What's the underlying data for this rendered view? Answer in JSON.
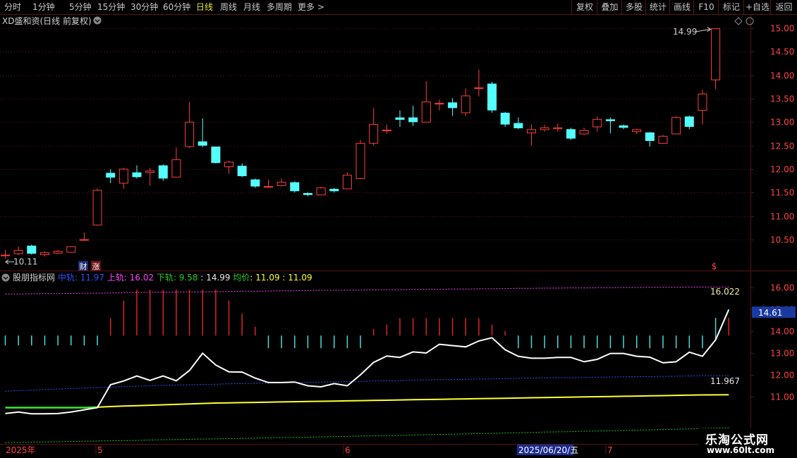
{
  "toolbar": {
    "periods": [
      "分时",
      "1分钟",
      "5分钟",
      "15分钟",
      "30分钟",
      "60分钟",
      "日线",
      "周线",
      "月线",
      "多周期",
      "更多 >"
    ],
    "active_period": "日线",
    "right_buttons": [
      "复权",
      "叠加",
      "多股",
      "统计",
      "画线",
      "F10",
      "标记",
      "+自选",
      "返回"
    ]
  },
  "main_chart": {
    "stock_title": "XD盛和资(日线 前复权)",
    "price_axis": [
      "15.00",
      "14.50",
      "14.00",
      "13.50",
      "13.00",
      "12.50",
      "12.00",
      "11.50",
      "11.00",
      "10.50"
    ],
    "high_label": "14.99",
    "low_label": "10.11",
    "badge_cai": "财",
    "badge_zhang": "涨",
    "s_marker": "$"
  },
  "indicator": {
    "name": "股朋指标网",
    "mid_label": "中轨",
    "mid_value": "11.97",
    "upper_label": "上轨",
    "upper_value": "16.02",
    "lower_label": "下轨",
    "lower_value": "9.58",
    "close_value": "14.99",
    "avg_label": "均价",
    "avg_value": "11.09",
    "avg_value2": "11.09",
    "upper_tag": "16.022",
    "mid_tag": "11.967",
    "current_tag": "14.61",
    "axis": [
      "16.00",
      "15.00",
      "14.00",
      "13.00",
      "12.00",
      "11.00"
    ]
  },
  "time_axis": {
    "year_label": "2025年",
    "month_5": "5",
    "month_6": "6",
    "month_7": "7",
    "cursor_date": "2025/06/20/五"
  },
  "watermark": {
    "title": "乐淘公式网",
    "url": "www.60lt.com"
  },
  "colors": {
    "up": "#ff3c3c",
    "down": "#54ffff",
    "grid": "#5a1414",
    "axis_text": "#ff4444",
    "mid": "#3050ff",
    "upper": "#ff44ff",
    "lower": "#22cc22",
    "avg": "#ffff30"
  },
  "candles": [
    {
      "o": 10.17,
      "c": 10.17,
      "h": 10.28,
      "l": 10.1
    },
    {
      "o": 10.2,
      "c": 10.27,
      "h": 10.35,
      "l": 10.17
    },
    {
      "o": 10.37,
      "c": 10.2,
      "h": 10.39,
      "l": 10.18
    },
    {
      "o": 10.18,
      "c": 10.22,
      "h": 10.25,
      "l": 10.14
    },
    {
      "o": 10.21,
      "c": 10.25,
      "h": 10.28,
      "l": 10.2
    },
    {
      "o": 10.23,
      "c": 10.35,
      "h": 10.36,
      "l": 10.22
    },
    {
      "o": 10.5,
      "c": 10.5,
      "h": 10.65,
      "l": 10.47
    },
    {
      "o": 10.81,
      "c": 11.55,
      "h": 11.58,
      "l": 10.8
    },
    {
      "o": 11.92,
      "c": 11.82,
      "h": 12.0,
      "l": 11.7
    },
    {
      "o": 11.7,
      "c": 12.0,
      "h": 12.03,
      "l": 11.58
    },
    {
      "o": 11.93,
      "c": 11.83,
      "h": 12.08,
      "l": 11.8
    },
    {
      "o": 11.93,
      "c": 11.96,
      "h": 12.03,
      "l": 11.65
    },
    {
      "o": 12.08,
      "c": 11.8,
      "h": 12.1,
      "l": 11.75
    },
    {
      "o": 11.83,
      "c": 12.2,
      "h": 12.46,
      "l": 11.82
    },
    {
      "o": 12.48,
      "c": 13.0,
      "h": 13.43,
      "l": 12.45
    },
    {
      "o": 12.59,
      "c": 12.5,
      "h": 13.08,
      "l": 12.47
    },
    {
      "o": 12.48,
      "c": 12.13,
      "h": 12.48,
      "l": 12.12
    },
    {
      "o": 12.05,
      "c": 12.15,
      "h": 12.18,
      "l": 11.9
    },
    {
      "o": 12.07,
      "c": 11.85,
      "h": 12.12,
      "l": 11.83
    },
    {
      "o": 11.78,
      "c": 11.63,
      "h": 11.8,
      "l": 11.6
    },
    {
      "o": 11.63,
      "c": 11.63,
      "h": 11.78,
      "l": 11.6
    },
    {
      "o": 11.65,
      "c": 11.72,
      "h": 11.8,
      "l": 11.63
    },
    {
      "o": 11.72,
      "c": 11.53,
      "h": 11.74,
      "l": 11.5
    },
    {
      "o": 11.49,
      "c": 11.45,
      "h": 11.51,
      "l": 11.42
    },
    {
      "o": 11.45,
      "c": 11.6,
      "h": 11.63,
      "l": 11.45
    },
    {
      "o": 11.58,
      "c": 11.53,
      "h": 11.6,
      "l": 11.5
    },
    {
      "o": 11.58,
      "c": 11.87,
      "h": 11.93,
      "l": 11.57
    },
    {
      "o": 11.8,
      "c": 12.55,
      "h": 12.62,
      "l": 11.79
    },
    {
      "o": 12.55,
      "c": 12.95,
      "h": 13.3,
      "l": 12.5
    },
    {
      "o": 12.83,
      "c": 12.83,
      "h": 12.95,
      "l": 12.75
    },
    {
      "o": 13.1,
      "c": 13.05,
      "h": 13.25,
      "l": 12.9
    },
    {
      "o": 13.1,
      "c": 13.0,
      "h": 13.35,
      "l": 12.92
    },
    {
      "o": 13.0,
      "c": 13.43,
      "h": 13.87,
      "l": 13.0
    },
    {
      "o": 13.4,
      "c": 13.4,
      "h": 13.48,
      "l": 13.25
    },
    {
      "o": 13.42,
      "c": 13.3,
      "h": 13.51,
      "l": 13.13
    },
    {
      "o": 13.2,
      "c": 13.56,
      "h": 13.72,
      "l": 13.13
    },
    {
      "o": 13.73,
      "c": 13.73,
      "h": 14.12,
      "l": 13.55
    },
    {
      "o": 13.82,
      "c": 13.25,
      "h": 13.86,
      "l": 13.2
    },
    {
      "o": 13.2,
      "c": 12.95,
      "h": 13.22,
      "l": 12.9
    },
    {
      "o": 12.98,
      "c": 12.87,
      "h": 13.1,
      "l": 12.85
    },
    {
      "o": 12.77,
      "c": 12.84,
      "h": 12.95,
      "l": 12.5
    },
    {
      "o": 12.84,
      "c": 12.88,
      "h": 12.94,
      "l": 12.8
    },
    {
      "o": 12.86,
      "c": 12.88,
      "h": 12.97,
      "l": 12.8
    },
    {
      "o": 12.85,
      "c": 12.65,
      "h": 12.88,
      "l": 12.62
    },
    {
      "o": 12.75,
      "c": 12.82,
      "h": 12.88,
      "l": 12.73
    },
    {
      "o": 12.9,
      "c": 13.06,
      "h": 13.12,
      "l": 12.8
    },
    {
      "o": 13.06,
      "c": 13.02,
      "h": 13.1,
      "l": 12.76
    },
    {
      "o": 12.93,
      "c": 12.88,
      "h": 12.95,
      "l": 12.85
    },
    {
      "o": 12.8,
      "c": 12.84,
      "h": 12.86,
      "l": 12.75
    },
    {
      "o": 12.78,
      "c": 12.6,
      "h": 12.79,
      "l": 12.48
    },
    {
      "o": 12.55,
      "c": 12.7,
      "h": 12.73,
      "l": 12.54
    },
    {
      "o": 12.75,
      "c": 13.1,
      "h": 13.13,
      "l": 12.74
    },
    {
      "o": 13.12,
      "c": 12.9,
      "h": 13.14,
      "l": 12.85
    },
    {
      "o": 13.25,
      "c": 13.6,
      "h": 13.69,
      "l": 12.95
    },
    {
      "o": 13.9,
      "c": 14.99,
      "h": 14.99,
      "l": 13.7
    }
  ],
  "indicator_series": {
    "white": [
      10.23,
      10.3,
      10.22,
      10.22,
      10.23,
      10.3,
      10.4,
      10.5,
      11.55,
      11.72,
      11.95,
      11.75,
      11.95,
      11.73,
      12.2,
      12.99,
      12.45,
      12.14,
      12.13,
      11.85,
      11.65,
      11.65,
      11.67,
      11.5,
      11.45,
      11.6,
      11.5,
      12.0,
      12.57,
      12.86,
      12.8,
      13.05,
      13.0,
      13.4,
      13.34,
      13.28,
      13.55,
      13.7,
      13.15,
      12.85,
      12.76,
      12.76,
      12.8,
      12.8,
      12.6,
      12.71,
      12.98,
      12.98,
      12.85,
      12.81,
      12.55,
      12.6,
      13.04,
      12.85,
      13.6,
      14.99
    ],
    "mid": [
      11.25,
      11.28,
      11.3,
      11.33,
      11.35,
      11.37,
      11.4,
      11.42,
      11.44,
      11.46,
      11.48,
      11.5,
      11.52,
      11.53,
      11.55,
      11.56,
      11.57,
      11.59,
      11.6,
      11.61,
      11.63,
      11.64,
      11.65,
      11.66,
      11.67,
      11.68,
      11.69,
      11.7,
      11.72,
      11.73,
      11.74,
      11.76,
      11.77,
      11.78,
      11.79,
      11.8,
      11.81,
      11.82,
      11.83,
      11.84,
      11.85,
      11.86,
      11.87,
      11.87,
      11.88,
      11.89,
      11.9,
      11.91,
      11.92,
      11.92,
      11.93,
      11.94,
      11.95,
      11.96,
      11.96,
      11.967
    ],
    "upper": [
      15.7,
      15.7,
      15.71,
      15.72,
      15.72,
      15.73,
      15.74,
      15.74,
      15.75,
      15.76,
      15.77,
      15.78,
      15.78,
      15.79,
      15.8,
      15.8,
      15.81,
      15.82,
      15.83,
      15.83,
      15.84,
      15.85,
      15.85,
      15.86,
      15.87,
      15.87,
      15.88,
      15.88,
      15.89,
      15.9,
      15.9,
      15.91,
      15.92,
      15.92,
      15.93,
      15.93,
      15.94,
      15.94,
      15.95,
      15.96,
      15.96,
      15.97,
      15.97,
      15.98,
      15.98,
      15.99,
      15.99,
      16.0,
      16.0,
      16.01,
      16.01,
      16.01,
      16.02,
      16.02,
      16.02,
      16.022
    ],
    "lower": [
      8.9,
      8.91,
      8.92,
      8.93,
      8.94,
      8.95,
      8.96,
      8.97,
      8.98,
      8.99,
      9.0,
      9.02,
      9.03,
      9.04,
      9.05,
      9.06,
      9.07,
      9.08,
      9.09,
      9.1,
      9.12,
      9.13,
      9.14,
      9.15,
      9.16,
      9.17,
      9.18,
      9.2,
      9.21,
      9.22,
      9.23,
      9.25,
      9.26,
      9.27,
      9.28,
      9.3,
      9.31,
      9.32,
      9.34,
      9.35,
      9.36,
      9.38,
      9.39,
      9.4,
      9.42,
      9.43,
      9.44,
      9.45,
      9.47,
      9.48,
      9.5,
      9.51,
      9.53,
      9.55,
      9.56,
      9.58
    ],
    "avg": [
      10.5,
      10.5,
      10.5,
      10.5,
      10.5,
      10.5,
      10.5,
      10.52,
      10.55,
      10.57,
      10.59,
      10.61,
      10.63,
      10.65,
      10.67,
      10.69,
      10.71,
      10.72,
      10.73,
      10.74,
      10.75,
      10.76,
      10.77,
      10.78,
      10.79,
      10.8,
      10.81,
      10.82,
      10.83,
      10.84,
      10.85,
      10.86,
      10.87,
      10.88,
      10.89,
      10.9,
      10.91,
      10.92,
      10.93,
      10.94,
      10.95,
      10.96,
      10.97,
      10.98,
      10.99,
      11.0,
      11.01,
      11.02,
      11.03,
      11.04,
      11.05,
      11.06,
      11.07,
      11.08,
      11.085,
      11.09
    ],
    "green_until": 7,
    "bars": [
      13.8,
      13.8,
      13.8,
      13.8,
      13.8,
      13.8,
      13.8,
      13.8,
      14.6,
      15.4,
      15.9,
      15.9,
      15.9,
      15.9,
      15.9,
      15.9,
      15.9,
      15.4,
      14.8,
      14.2,
      13.7,
      13.7,
      13.4,
      13.0,
      13.0,
      13.0,
      13.1,
      13.7,
      14.1,
      14.3,
      14.6,
      14.6,
      14.6,
      14.6,
      14.6,
      14.6,
      14.6,
      14.3,
      14.0,
      13.6,
      13.4,
      13.3,
      13.3,
      13.2,
      13.2,
      13.1,
      13.0,
      13.0,
      13.0,
      13.0,
      13.0,
      13.0,
      13.1,
      13.3,
      13.7,
      14.61
    ]
  }
}
